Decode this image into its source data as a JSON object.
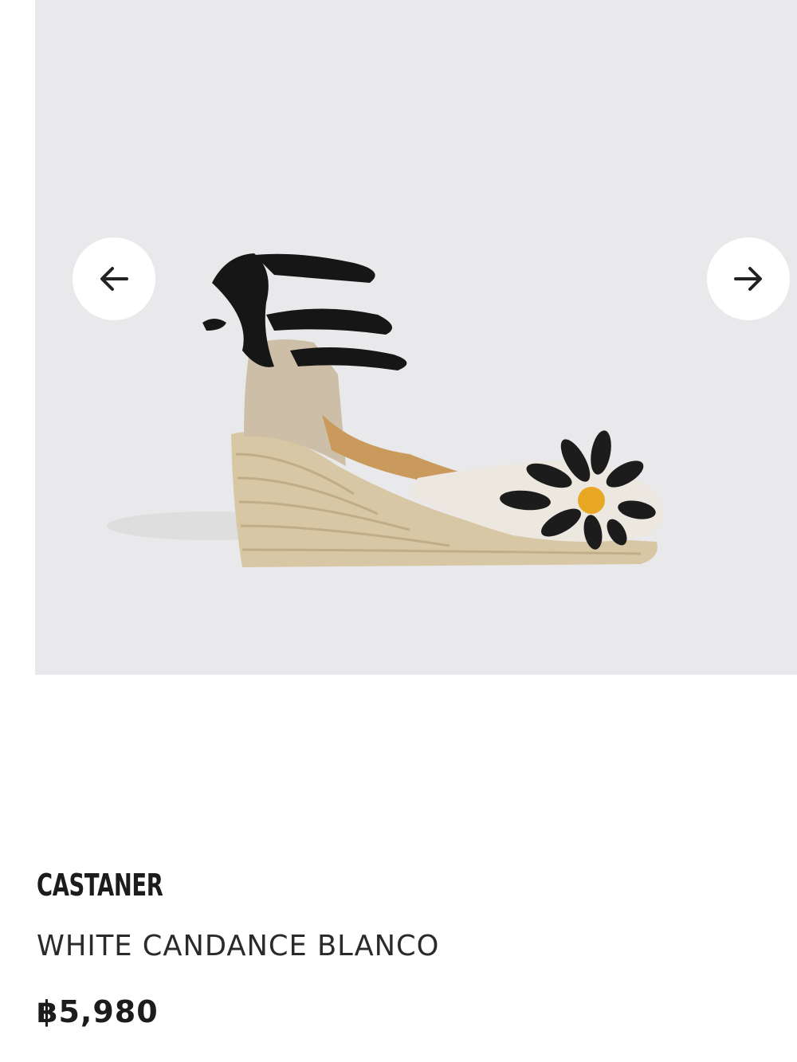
{
  "gallery": {
    "image_alt": "Espadrille wedge with black ankle ties and flower appliqué",
    "prev_icon": "arrow-left-icon",
    "next_icon": "arrow-right-icon",
    "colors": {
      "background": "#e9e9eb",
      "button": "#ffffff",
      "icon": "#222222"
    }
  },
  "product": {
    "brand": "CASTANER",
    "name": "WHITE CANDANCE BLANCO",
    "price": "฿5,980"
  }
}
